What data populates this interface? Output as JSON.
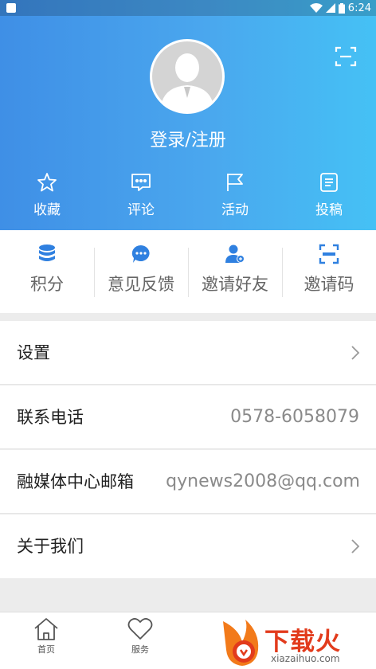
{
  "status_bar": {
    "time": "6:24"
  },
  "header": {
    "login_label": "登录/注册",
    "icons": [
      "scan-icon",
      "avatar-placeholder"
    ],
    "quick_actions": [
      {
        "label": "收藏",
        "icon": "star-icon"
      },
      {
        "label": "评论",
        "icon": "comment-icon"
      },
      {
        "label": "活动",
        "icon": "flag-icon"
      },
      {
        "label": "投稿",
        "icon": "document-icon"
      }
    ]
  },
  "features": [
    {
      "label": "积分",
      "icon": "database-icon"
    },
    {
      "label": "意见反馈",
      "icon": "chat-bubble-icon"
    },
    {
      "label": "邀请好友",
      "icon": "add-user-icon"
    },
    {
      "label": "邀请码",
      "icon": "code-frame-icon"
    }
  ],
  "menu": {
    "settings": "设置",
    "phone_label": "联系电话",
    "phone_value": "0578-6058079",
    "email_label": "融媒体中心邮箱",
    "email_value": "qynews2008@qq.com",
    "about": "关于我们"
  },
  "tabbar": {
    "tabs": [
      {
        "label": "首页",
        "icon": "home-icon"
      },
      {
        "label": "服务",
        "icon": "heart-icon"
      }
    ]
  },
  "watermark": {
    "text": "下载火",
    "sub": "xiazaihuo.com"
  },
  "colors": {
    "header_start": "#3f8fe6",
    "header_end": "#45c1f5",
    "accent": "#2f80e0",
    "watermark": "#e23b1c"
  }
}
